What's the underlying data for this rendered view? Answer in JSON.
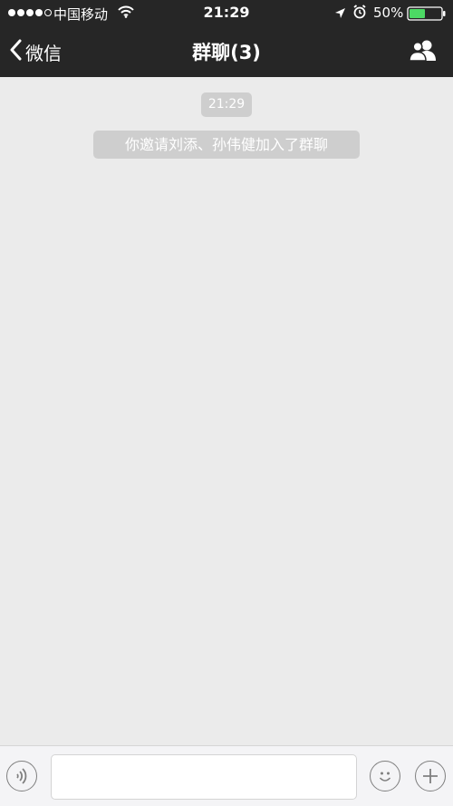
{
  "status_bar": {
    "carrier": "中国移动",
    "time": "21:29",
    "battery_percent": "50%",
    "battery_level": 0.5,
    "signal_strength": 4,
    "signal_max": 5,
    "icons": [
      "wifi-icon",
      "location-icon",
      "alarm-icon",
      "battery-icon"
    ]
  },
  "nav_bar": {
    "back_label": "微信",
    "title": "群聊(3)",
    "right_icon": "group-members-icon"
  },
  "chat": {
    "timestamp": "21:29",
    "system_message": "你邀请刘添、孙伟健加入了群聊"
  },
  "input_bar": {
    "message_value": "",
    "icons": [
      "voice-icon",
      "emoji-icon",
      "plus-icon"
    ]
  },
  "colors": {
    "bar_background": "#262626",
    "chat_background": "#ebebeb",
    "notice_background": "#cecece",
    "battery_fill": "#4cd964"
  }
}
